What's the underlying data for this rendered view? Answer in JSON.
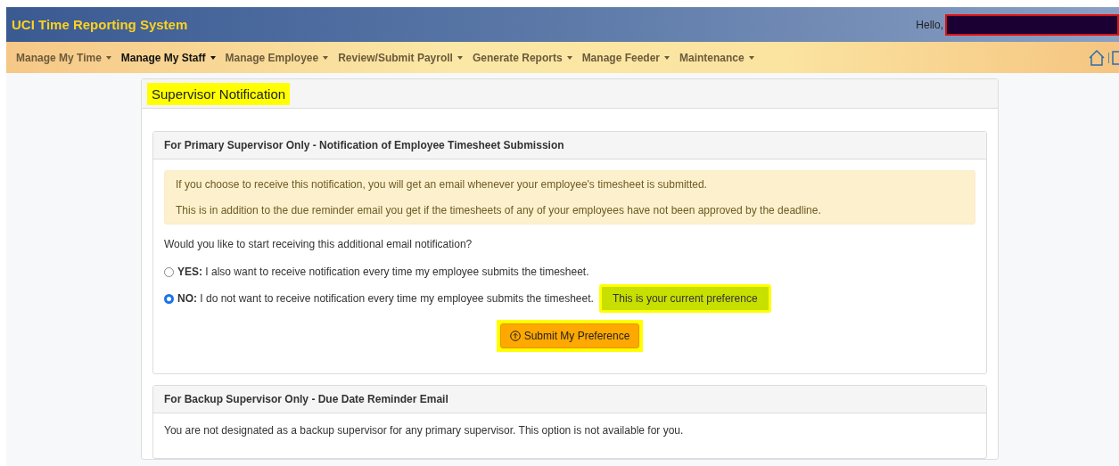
{
  "header": {
    "title": "UCI Time Reporting System",
    "greeting": "Hello,"
  },
  "nav": [
    {
      "label": "Manage My Time",
      "selected": false
    },
    {
      "label": "Manage My Staff",
      "selected": true
    },
    {
      "label": "Manage Employee",
      "selected": false
    },
    {
      "label": "Review/Submit Payroll",
      "selected": false
    },
    {
      "label": "Generate Reports",
      "selected": false
    },
    {
      "label": "Manage Feeder",
      "selected": false
    },
    {
      "label": "Maintenance",
      "selected": false
    }
  ],
  "page": {
    "title": "Supervisor Notification",
    "primary": {
      "title": "For Primary Supervisor Only - Notification of Employee Timesheet Submission",
      "notice": [
        "If you choose to receive this notification, you will get an email whenever your employee's timesheet is submitted.",
        "This is in addition to the due reminder email you get if the timesheets of any of your employees have not been approved by the deadline."
      ],
      "question": "Would you like to start receiving this additional email notification?",
      "options": [
        {
          "text": "**YES:** I also want to receive notification every time my employee submits the timesheet.",
          "checked": false
        },
        {
          "text": "**NO:** I do not want to receive notification every time my employee submits the timesheet.",
          "checked": true,
          "badge": "This is your current preference"
        }
      ],
      "submit": "Submit My Preference"
    },
    "backup": {
      "title": "For Backup Supervisor Only - Due Date Reminder Email",
      "text": "You are not designated as a backup supervisor for any primary supervisor. This option is not available for you."
    }
  }
}
